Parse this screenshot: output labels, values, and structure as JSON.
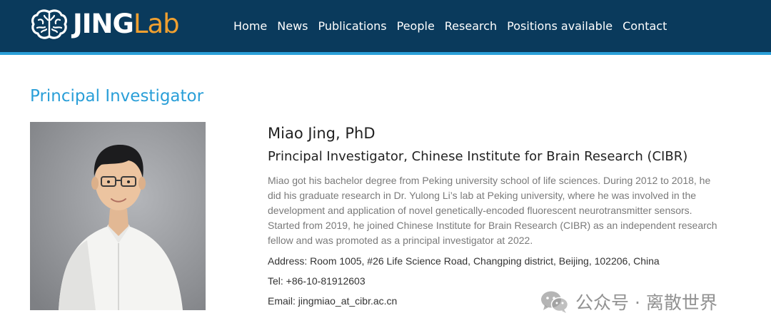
{
  "header": {
    "logo": {
      "part1": "JING",
      "part2": "Lab",
      "icon": "brain-icon",
      "colors": {
        "bar": "#0a3a5c",
        "accent_line": "#2a9fd8",
        "lab_text": "#f0a030"
      }
    },
    "nav_items": [
      {
        "label": "Home"
      },
      {
        "label": "News"
      },
      {
        "label": "Publications"
      },
      {
        "label": "People"
      },
      {
        "label": "Research"
      },
      {
        "label": "Positions available"
      },
      {
        "label": "Contact"
      }
    ]
  },
  "main": {
    "section_title": "Principal Investigator",
    "title_color": "#2a9fd8",
    "profile": {
      "photo": "portrait-photo",
      "name": "Miao Jing, PhD",
      "position": "Principal Investigator, Chinese Institute for Brain Research (CIBR)",
      "bio": "Miao got his bachelor degree from Peking university school of life sciences. During 2012 to 2018, he did his graduate research in Dr. Yulong Li’s lab at Peking university, where he was involved in the development and application of novel genetically-encoded fluorescent neurotransmitter sensors. Started from 2019, he joined Chinese Institute for Brain Research (CIBR) as an independent research fellow and was promoted as a principal investigator at 2022.",
      "address": "Address: Room 1005, #26 Life Science Road, Changping district, Beijing, 102206, China",
      "tel": "Tel: +86-10-81912603",
      "email": "Email: jingmiao_at_cibr.ac.cn"
    }
  },
  "watermark": {
    "icon": "wechat-icon",
    "text": "公众号 · 离散世界"
  }
}
